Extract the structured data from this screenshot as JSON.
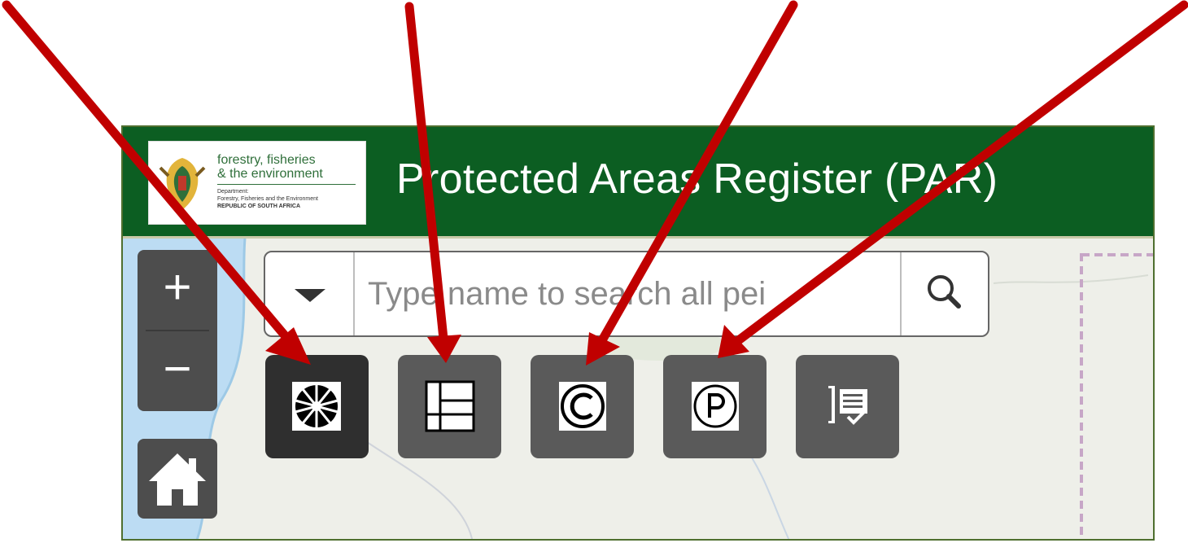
{
  "header": {
    "title": "Protected Areas Register (PAR)",
    "logo": {
      "line1": "forestry, fisheries",
      "line2": "& the environment",
      "line3": "Department:",
      "line4": "Forestry, Fisheries and the Environment",
      "line5": "REPUBLIC OF SOUTH AFRICA"
    },
    "background_color": "#0c5e22"
  },
  "zoom": {
    "in_label": "+",
    "out_label": "−"
  },
  "home": {
    "icon": "home-icon"
  },
  "search": {
    "placeholder": "Type name to search all pei",
    "value": "",
    "dropdown_icon": "caret-down-icon",
    "search_icon": "search-icon"
  },
  "toolbar": {
    "tools": [
      {
        "name": "basemap-gallery",
        "icon": "basemap-gallery-icon",
        "active": true
      },
      {
        "name": "layer-list",
        "icon": "layer-list-icon",
        "active": false
      },
      {
        "name": "attribution",
        "icon": "copyright-icon",
        "active": false
      },
      {
        "name": "parking",
        "icon": "p-circle-icon",
        "active": false
      },
      {
        "name": "legend",
        "icon": "list-check-icon",
        "active": false
      }
    ]
  },
  "annotation": {
    "arrow_color": "#c00000"
  }
}
